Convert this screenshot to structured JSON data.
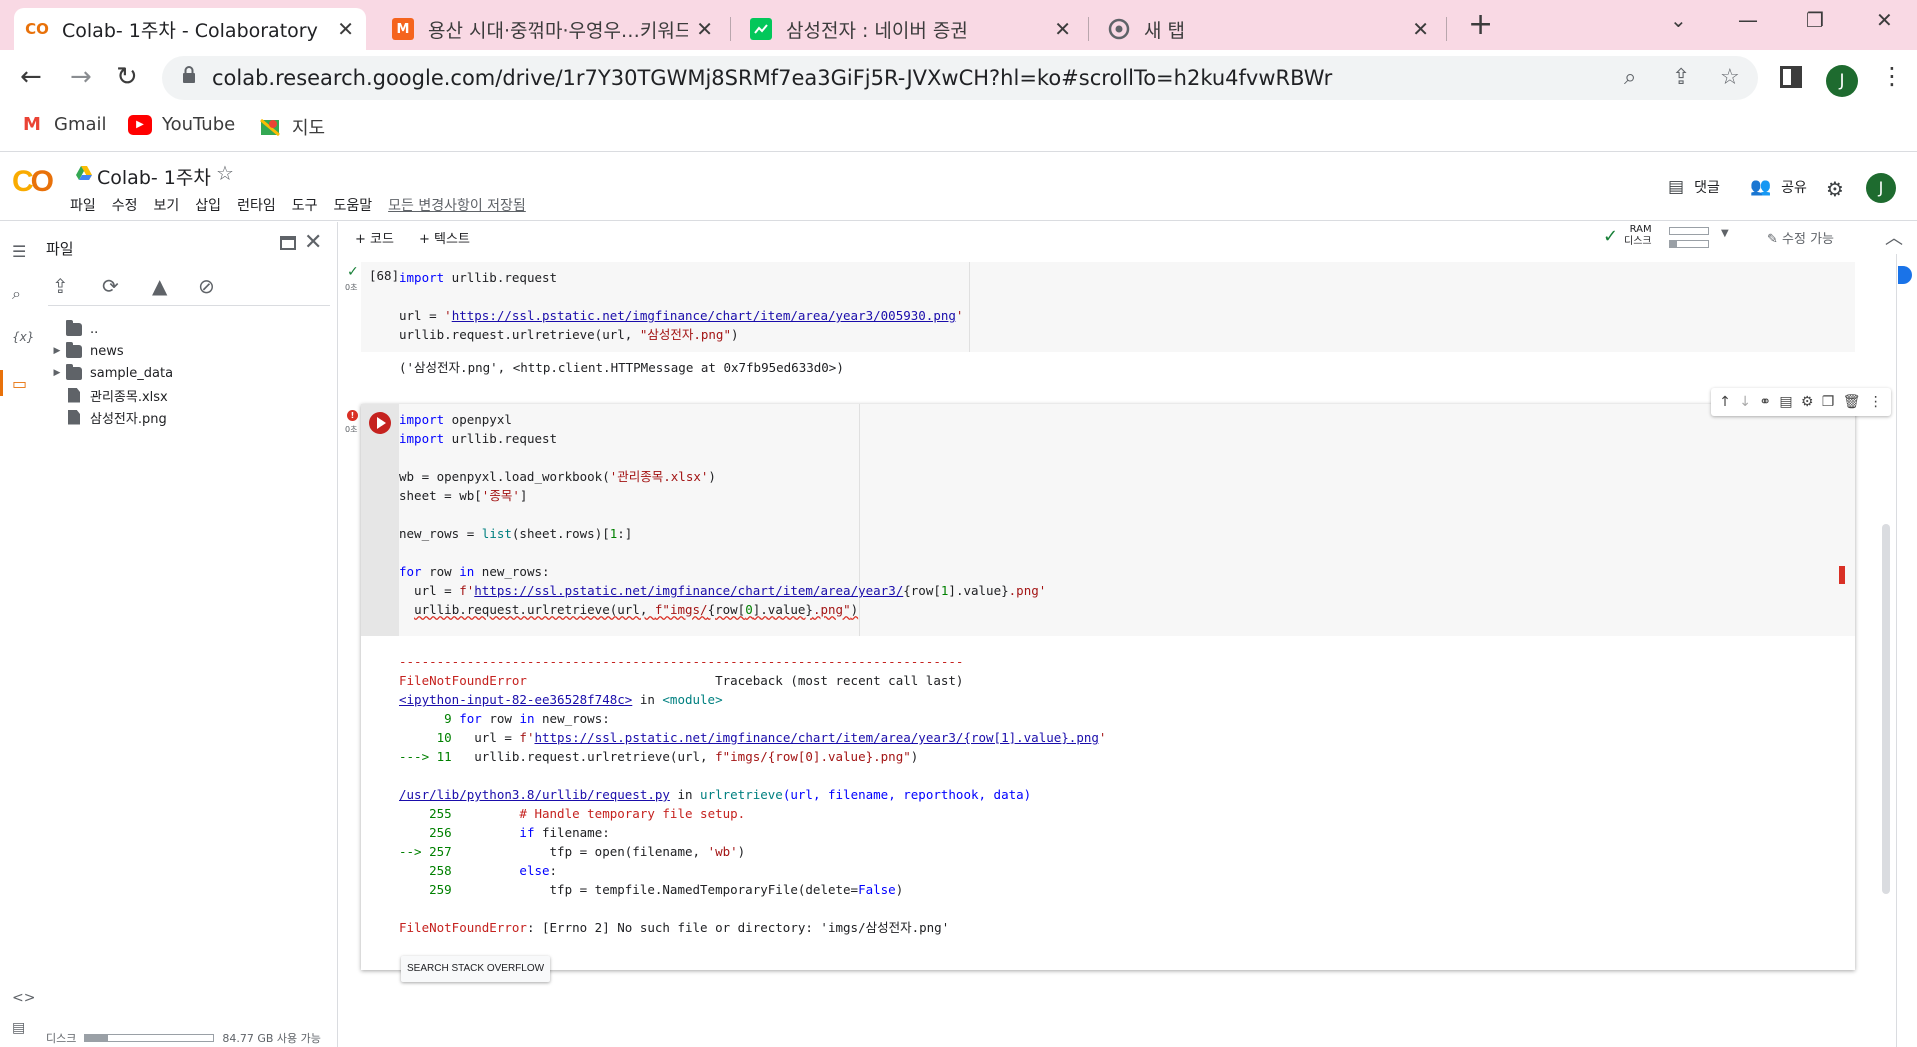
{
  "browser": {
    "tabs": [
      {
        "title": "Colab- 1주차 - Colaboratory",
        "favicon": "colab-icon",
        "favicon_text": "CO",
        "active": true
      },
      {
        "title": "용산 시대·중꺾마·우영우…키워드",
        "favicon": "m-icon",
        "favicon_text": "M"
      },
      {
        "title": "삼성전자 : 네이버 증권",
        "favicon": "chart-icon",
        "favicon_text": ""
      },
      {
        "title": "새 탭",
        "favicon": "chrome-icon",
        "favicon_text": ""
      }
    ],
    "url": "colab.research.google.com/drive/1r7Y30TGWMj8SRMf7ea3GiFj5R-JVXwCH?hl=ko#scrollTo=h2ku4fvwRBWr",
    "profile_initial": "J",
    "bookmarks": [
      {
        "label": "Gmail",
        "icon": "gmail-icon"
      },
      {
        "label": "YouTube",
        "icon": "youtube-icon"
      },
      {
        "label": "지도",
        "icon": "maps-icon"
      }
    ]
  },
  "colab": {
    "title": "Colab- 1주차",
    "menus": [
      "파일",
      "수정",
      "보기",
      "삽입",
      "런타임",
      "도구",
      "도움말"
    ],
    "saved_status": "모든 변경사항이 저장됨",
    "comment_label": "댓글",
    "share_label": "공유",
    "avatar_initial": "J",
    "add_code": "+ 코드",
    "add_text": "+ 텍스트",
    "ram_label": "RAM",
    "disk_label": "디스크",
    "edit_mode": "수정 가능"
  },
  "file_panel": {
    "title": "파일",
    "tree": [
      {
        "name": "..",
        "type": "folder-up",
        "expandable": false
      },
      {
        "name": "news",
        "type": "folder",
        "expandable": true
      },
      {
        "name": "sample_data",
        "type": "folder",
        "expandable": true
      },
      {
        "name": "관리종목.xlsx",
        "type": "file",
        "expandable": false
      },
      {
        "name": "삼성전자.png",
        "type": "file",
        "expandable": false
      }
    ],
    "disk_label": "디스크",
    "disk_free": "84.77 GB 사용 가능",
    "disk_used_fraction": 0.18
  },
  "cells": {
    "cell1": {
      "exec_count": "[68]",
      "time": "0초",
      "output": "('삼성전자.png', <http.client.HTTPMessage at 0x7fb95ed633d0>)"
    },
    "cell2": {
      "time": "0초",
      "search_button": "SEARCH STACK OVERFLOW"
    }
  }
}
